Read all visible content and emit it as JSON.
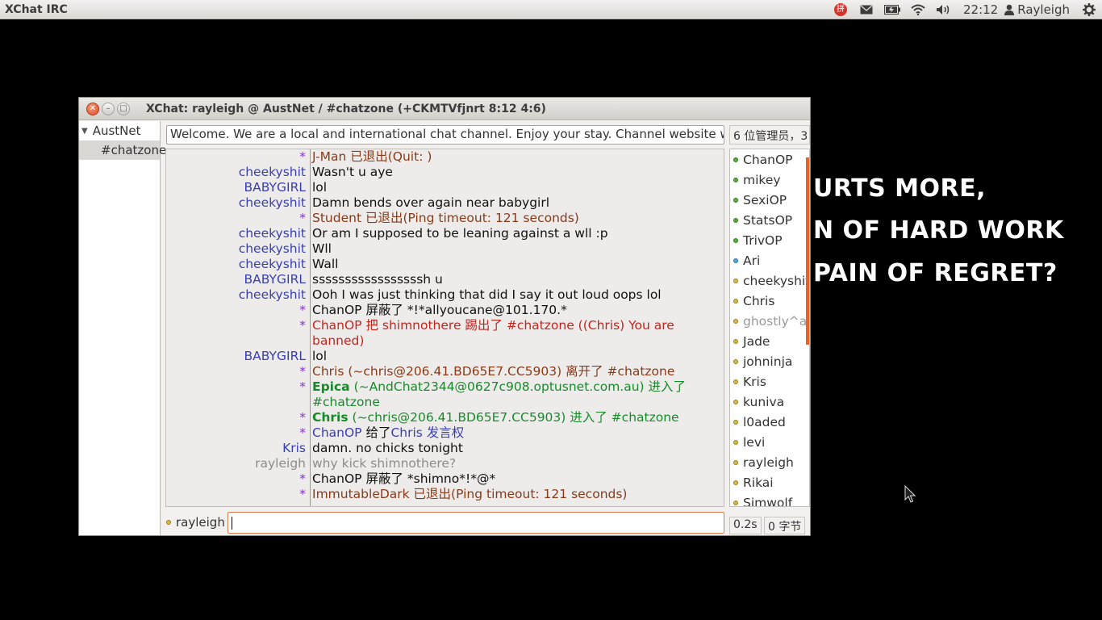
{
  "topbar": {
    "app_title": "XChat IRC",
    "clock": "22:12",
    "user": "Rayleigh",
    "icons": [
      "input-method-icon",
      "mail-icon",
      "battery-icon",
      "wifi-icon",
      "volume-icon",
      "gear-icon"
    ]
  },
  "wallpaper": {
    "lines": [
      "URTS MORE,",
      "N OF HARD WORK",
      "PAIN OF REGRET?"
    ]
  },
  "window": {
    "title": "XChat: rayleigh @ AustNet / #chatzone (+CKMTVfjnrt 8:12 4:6)",
    "tree": {
      "network": "AustNet",
      "channel": "#chatzone"
    },
    "topic": "Welcome. We are a local and international chat channel. Enjoy your stay. Channel website with st",
    "user_count": "6 位管理员，3",
    "messages": [
      {
        "nick": "*",
        "nick_class": "c-star",
        "parts": [
          {
            "t": "J-Man 已退出(Quit: )",
            "c": "c-quit"
          }
        ]
      },
      {
        "nick": "cheekyshit",
        "nick_class": "c-nick",
        "parts": [
          {
            "t": "Wasn't u aye",
            "c": "c-blk"
          }
        ]
      },
      {
        "nick": "BABYGIRL",
        "nick_class": "c-nick",
        "parts": [
          {
            "t": "lol",
            "c": "c-blk"
          }
        ]
      },
      {
        "nick": "cheekyshit",
        "nick_class": "c-nick",
        "parts": [
          {
            "t": "Damn bends over again near babygirl",
            "c": "c-blk"
          }
        ]
      },
      {
        "nick": "*",
        "nick_class": "c-star",
        "parts": [
          {
            "t": "Student 已退出(Ping timeout: 121 seconds)",
            "c": "c-quit"
          }
        ]
      },
      {
        "nick": "cheekyshit",
        "nick_class": "c-nick",
        "parts": [
          {
            "t": "Or am I supposed to be leaning against a wll :p",
            "c": "c-blk"
          }
        ]
      },
      {
        "nick": "cheekyshit",
        "nick_class": "c-nick",
        "parts": [
          {
            "t": "Wll",
            "c": "c-blk"
          }
        ]
      },
      {
        "nick": "cheekyshit",
        "nick_class": "c-nick",
        "parts": [
          {
            "t": "Wall",
            "c": "c-blk"
          }
        ]
      },
      {
        "nick": "BABYGIRL",
        "nick_class": "c-nick",
        "parts": [
          {
            "t": "sssssssssssssssssh u",
            "c": "c-blk"
          }
        ]
      },
      {
        "nick": "cheekyshit",
        "nick_class": "c-nick",
        "parts": [
          {
            "t": "Ooh I was just thinking that did I say it out loud oops lol",
            "c": "c-blk"
          }
        ]
      },
      {
        "nick": "*",
        "nick_class": "c-star",
        "parts": [
          {
            "t": "ChanOP 屏蔽了 *!*allyoucane@101.170.*",
            "c": "c-blk"
          }
        ]
      },
      {
        "nick": "*",
        "nick_class": "c-star",
        "parts": [
          {
            "t": "ChanOP 把 shimnothere 踢出了 #chatzone ((Chris) You are banned)",
            "c": "c-kick"
          }
        ]
      },
      {
        "nick": "BABYGIRL",
        "nick_class": "c-nick",
        "parts": [
          {
            "t": "lol",
            "c": "c-blk"
          }
        ]
      },
      {
        "nick": "*",
        "nick_class": "c-star",
        "parts": [
          {
            "t": "Chris (~chris@206.41.BD65E7.CC5903) 离开了 #chatzone",
            "c": "c-part"
          }
        ]
      },
      {
        "nick": "*",
        "nick_class": "c-star",
        "parts": [
          {
            "t": "Epica",
            "c": "c-join b"
          },
          {
            "t": " (~AndChat2344@0627c908.optusnet.com.au) 进入了 #chatzone",
            "c": "c-join"
          }
        ]
      },
      {
        "nick": "*",
        "nick_class": "c-star",
        "parts": [
          {
            "t": "Chris",
            "c": "c-join b"
          },
          {
            "t": " (~chris@206.41.BD65E7.CC5903) 进入了 #chatzone",
            "c": "c-join"
          }
        ]
      },
      {
        "nick": "*",
        "nick_class": "c-star",
        "parts": [
          {
            "t": "ChanOP",
            "c": "c-mode"
          },
          {
            "t": " 给了",
            "c": "c-blk"
          },
          {
            "t": "Chris",
            "c": "c-mode"
          },
          {
            "t": " 发言权",
            "c": "c-mode"
          }
        ]
      },
      {
        "nick": "Kris",
        "nick_class": "c-nick",
        "parts": [
          {
            "t": "damn. no chicks tonight",
            "c": "c-blk"
          }
        ]
      },
      {
        "nick": "rayleigh",
        "nick_class": "c-gray",
        "parts": [
          {
            "t": "why kick shimnothere?",
            "c": "c-gray"
          }
        ]
      },
      {
        "nick": "*",
        "nick_class": "c-star",
        "parts": [
          {
            "t": "ChanOP 屏蔽了 *shimno*!*@*",
            "c": "c-blk"
          }
        ]
      },
      {
        "nick": "*",
        "nick_class": "c-star",
        "parts": [
          {
            "t": "ImmutableDark 已退出(Ping timeout: 121 seconds)",
            "c": "c-quit"
          }
        ]
      }
    ],
    "users": [
      {
        "name": "ChanOP",
        "status": "op"
      },
      {
        "name": "mikey",
        "status": "op"
      },
      {
        "name": "SexiOP",
        "status": "op"
      },
      {
        "name": "StatsOP",
        "status": "op"
      },
      {
        "name": "TrivOP",
        "status": "op"
      },
      {
        "name": "Ari",
        "status": "voice"
      },
      {
        "name": "cheekyshit",
        "status": "normal"
      },
      {
        "name": "Chris",
        "status": "normal"
      },
      {
        "name": "ghostly^afk",
        "status": "away"
      },
      {
        "name": "Jade",
        "status": "normal"
      },
      {
        "name": "johninja",
        "status": "normal"
      },
      {
        "name": "Kris",
        "status": "normal"
      },
      {
        "name": "kuniva",
        "status": "normal"
      },
      {
        "name": "l0aded",
        "status": "normal"
      },
      {
        "name": "levi",
        "status": "normal"
      },
      {
        "name": "rayleigh",
        "status": "normal"
      },
      {
        "name": "Rikai",
        "status": "normal"
      },
      {
        "name": "Simwolf",
        "status": "normal"
      }
    ],
    "my_nick": "rayleigh",
    "input_value": "",
    "lag": "0.2s",
    "bytes": "0 字节"
  }
}
